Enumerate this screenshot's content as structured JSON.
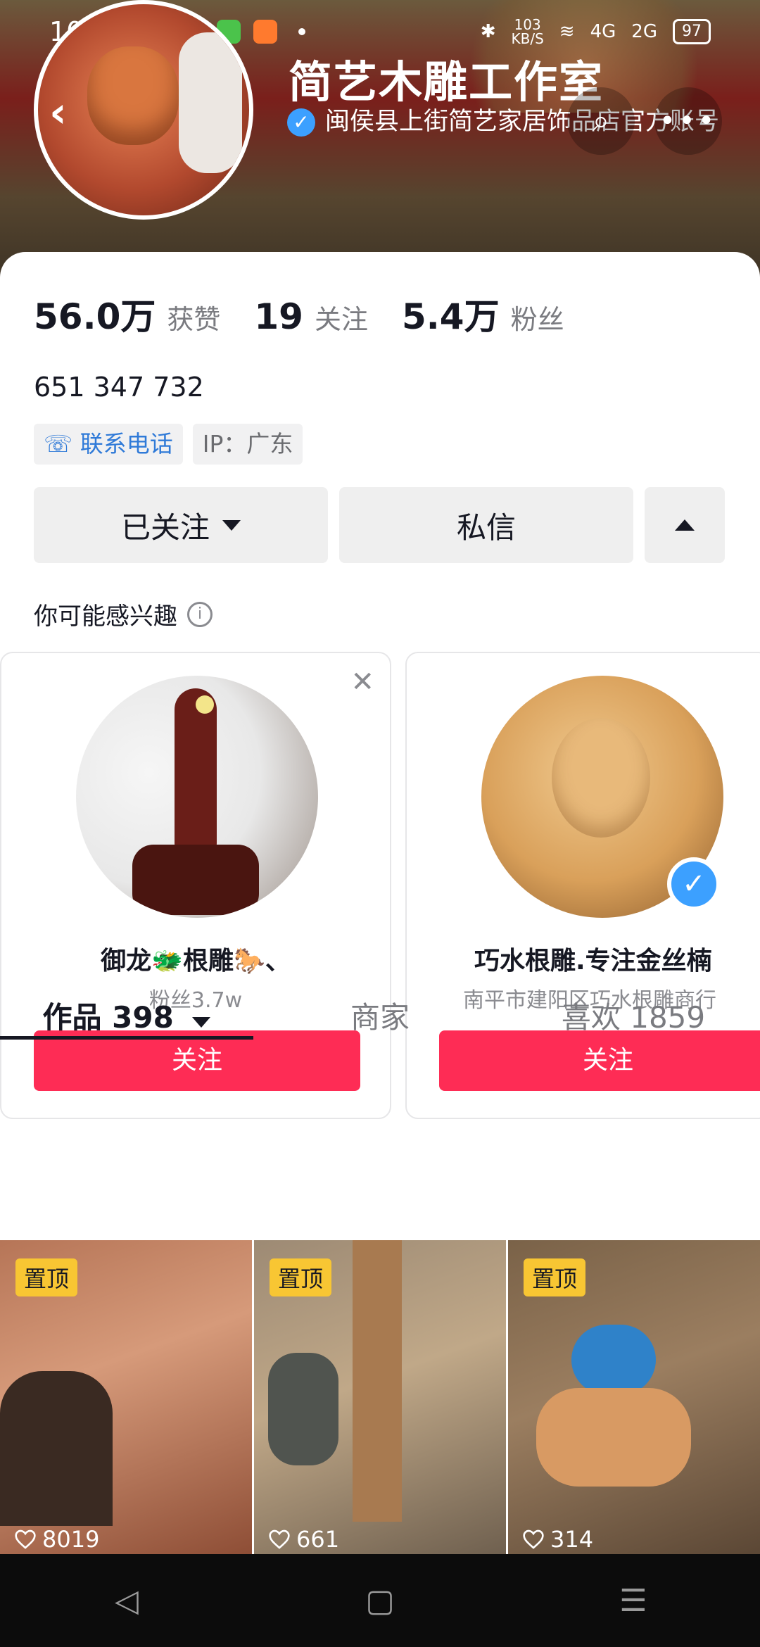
{
  "status_bar": {
    "time": "10:12",
    "network_speed": "103\nKB/S",
    "battery": "97",
    "signal_a": "4G",
    "signal_b": "2G"
  },
  "profile": {
    "name": "简艺木雕工作室",
    "verification": "闽侯县上街简艺家居饰品店官方账号",
    "likes_count": "56.0万",
    "likes_label": "获赞",
    "following_count": "19",
    "following_label": "关注",
    "followers_count": "5.4万",
    "followers_label": "粉丝",
    "uid": "651 347 732",
    "phone_tag": "联系电话",
    "ip_tag": "IP：广东"
  },
  "actions": {
    "followed_label": "已关注",
    "message_label": "私信"
  },
  "suggestions": {
    "title": "你可能感兴趣",
    "items": [
      {
        "name": "御龙🐲根雕🐎、",
        "subtitle": "粉丝3.7w",
        "button": "关注"
      },
      {
        "name": "巧水根雕.专注金丝楠",
        "subtitle": "南平市建阳区巧水根雕商行",
        "button": "关注"
      }
    ]
  },
  "tabs": [
    {
      "label": "作品 398"
    },
    {
      "label": "商家"
    },
    {
      "label": "喜欢 1859"
    }
  ],
  "videos": [
    {
      "pin": "置顶",
      "likes": "8019"
    },
    {
      "pin": "置顶",
      "likes": "661"
    },
    {
      "pin": "置顶",
      "likes": "314"
    }
  ],
  "colors": {
    "accent": "#fe2c55",
    "pin_badge": "#f8c633",
    "verified": "#3ca0ff"
  }
}
